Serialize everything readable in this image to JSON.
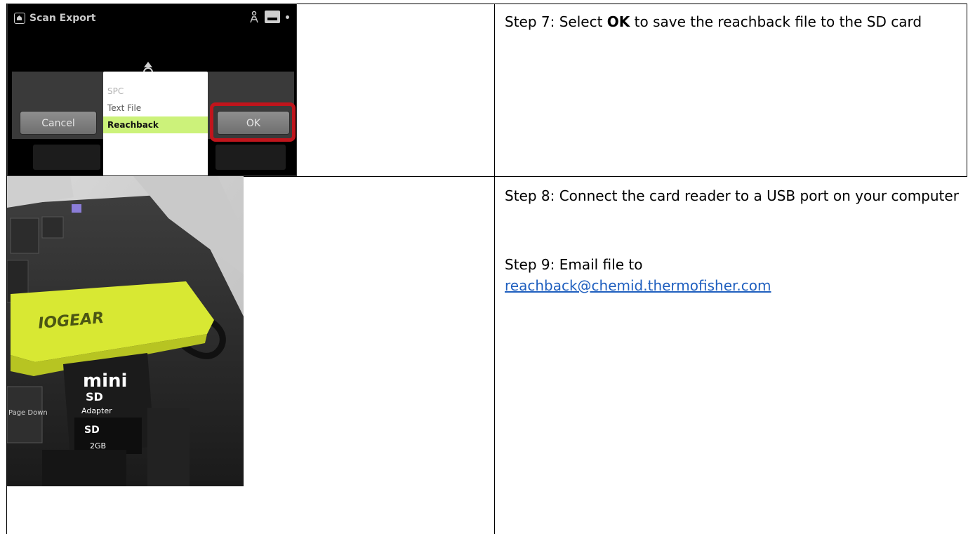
{
  "device_screen": {
    "title": "Scan Export",
    "status_icons": [
      "person-icon",
      "sd-card-icon",
      "dot-icon"
    ],
    "cancel_label": "Cancel",
    "ok_label": "OK",
    "menu_items": [
      "SPC",
      "Text File",
      "Reachback"
    ],
    "selected_item": "Reachback",
    "highlight_color": "#c0151c",
    "selection_color": "#ccf27a"
  },
  "photo": {
    "brand": "IOGEAR",
    "card_label_1": "mini",
    "card_label_2": "SD",
    "card_label_3": "Adapter",
    "card_label_4": "SD",
    "card_capacity": "2GB",
    "key_label": "Page Down",
    "reader_color": "#d8e833"
  },
  "steps": {
    "step7_prefix": "Step 7: Select ",
    "step7_bold": "OK",
    "step7_suffix": " to save the reachback file to the SD card",
    "step8": "Step 8:  Connect the card reader to a USB port on your computer",
    "step9": "Step 9: Email file to",
    "email": "reachback@chemid.thermofisher.com",
    "link_color": "#1f5fbf"
  }
}
